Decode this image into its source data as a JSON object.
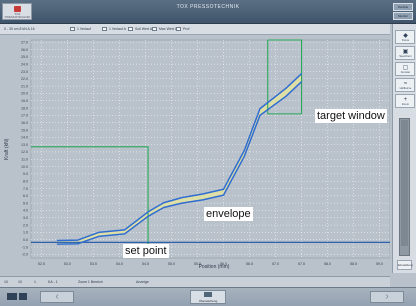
{
  "window": {
    "title": "TOX PRESSOTECHNIK",
    "logo_text": "TOX PRESSOTECHNIK"
  },
  "system_buttons": [
    "Flexible",
    "Monitor"
  ],
  "toolbar": {
    "items": [
      {
        "label": "0 - 30 cm 8 kN A 16"
      },
      {
        "label": "1 Verlauf"
      },
      {
        "label": "1 Verlauf A"
      },
      {
        "label": "Soll Wert A"
      },
      {
        "label": "Max Wert A"
      },
      {
        "label": "Prof"
      }
    ]
  },
  "right_panel": {
    "buttons": [
      {
        "label": "Kurve",
        "icon": "graph-icon"
      },
      {
        "label": "Speichern",
        "icon": "save-icon"
      },
      {
        "label": "Fenster",
        "icon": "window-icon"
      },
      {
        "label": "Hüllkurve",
        "icon": "envelope-icon"
      },
      {
        "label": "Zoom",
        "icon": "zoom-icon"
      }
    ],
    "bottom_button": "Einstellung"
  },
  "annotations": {
    "target_window": "target window",
    "envelope": "envelope",
    "set_point": "set point"
  },
  "statusbar": {
    "items": [
      "10",
      "10",
      "1",
      "KA - 1",
      "Zoom 1 Bereich",
      "Anzeige"
    ]
  },
  "bottom_bar": {
    "center_button": "Überwachung"
  },
  "colors": {
    "chart_bg": "#b9c2cb",
    "grid": "#ffffff",
    "curve": "#2f6dd0",
    "envelope_fill": "#dfdfa4",
    "window": "#29a85a",
    "set_point": "#1f55aa"
  },
  "chart_data": {
    "type": "line",
    "title": "",
    "xlabel": "Position (mm)",
    "ylabel": "Kraft (kN)",
    "xlim": [
      52.3,
      59.2
    ],
    "ylim": [
      -2.5,
      27.3
    ],
    "x_ticks": [
      "52.5",
      "53.0",
      "53.5",
      "54.0",
      "54.5",
      "55.0",
      "55.5",
      "56.0",
      "56.5",
      "57.0",
      "57.5",
      "58.0",
      "58.5",
      "59.0"
    ],
    "y_ticks": [
      "-2.0",
      "-1.0",
      "0.0",
      "1.0",
      "2.0",
      "3.0",
      "4.0",
      "5.0",
      "6.0",
      "7.0",
      "8.0",
      "9.0",
      "10.0",
      "11.0",
      "12.0",
      "13.0",
      "14.0",
      "15.0",
      "16.0",
      "17.0",
      "18.0",
      "19.0",
      "20.0",
      "21.0",
      "22.0",
      "23.0",
      "24.0",
      "25.0",
      "26.0",
      "27.0"
    ],
    "grid": true,
    "series": [
      {
        "points": [
          [
            52.8,
            -0.6
          ],
          [
            53.2,
            -0.55
          ],
          [
            53.6,
            0.45
          ],
          [
            54.1,
            0.8
          ],
          [
            54.55,
            3.2
          ],
          [
            54.85,
            4.4
          ],
          [
            55.2,
            5.0
          ],
          [
            55.6,
            5.45
          ],
          [
            56.0,
            6.1
          ],
          [
            56.4,
            11.4
          ],
          [
            56.7,
            17.0
          ],
          [
            57.2,
            19.6
          ],
          [
            57.5,
            21.6
          ]
        ],
        "color": "#2f6dd0"
      },
      {
        "points": [
          [
            52.8,
            -0.1
          ],
          [
            53.2,
            -0.05
          ],
          [
            53.6,
            1.0
          ],
          [
            54.1,
            1.35
          ],
          [
            54.55,
            3.8
          ],
          [
            54.85,
            5.05
          ],
          [
            55.2,
            5.75
          ],
          [
            55.6,
            6.25
          ],
          [
            56.0,
            6.9
          ],
          [
            56.4,
            12.2
          ],
          [
            56.7,
            17.9
          ],
          [
            57.2,
            20.7
          ],
          [
            57.5,
            22.7
          ]
        ],
        "color": "#2f6dd0"
      }
    ],
    "set_point_y": -0.35,
    "windows": [
      {
        "x": [
          52.3,
          54.55
        ],
        "y": [
          -2.5,
          12.7
        ]
      },
      {
        "x": [
          56.85,
          57.5
        ],
        "y": [
          17.2,
          27.3
        ]
      }
    ]
  }
}
